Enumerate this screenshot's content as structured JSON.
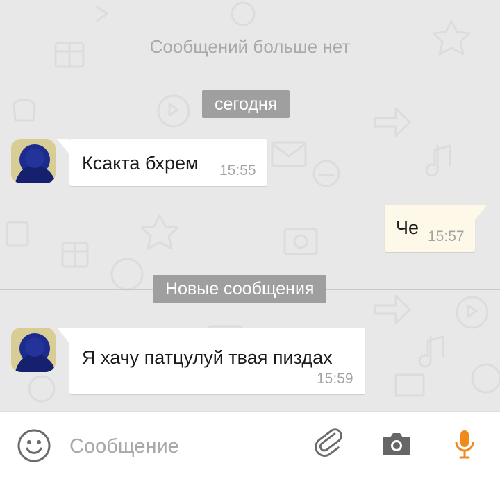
{
  "chat": {
    "no_more_label": "Сообщений больше нет",
    "date_label": "сегодня",
    "new_messages_label": "Новые сообщения",
    "messages": [
      {
        "direction": "incoming",
        "text": "Ксакта бхрем",
        "time": "15:55"
      },
      {
        "direction": "outgoing",
        "text": "Че",
        "time": "15:57"
      },
      {
        "direction": "incoming",
        "text": "Я хачу патцулуй твая пиздах",
        "time": "15:59"
      }
    ]
  },
  "composer": {
    "placeholder": "Сообщение",
    "value": ""
  },
  "icons": {
    "emoji": "smiley-icon",
    "attach": "paperclip-icon",
    "camera": "camera-icon",
    "mic": "microphone-icon"
  },
  "colors": {
    "accent_mic": "#f08a1e",
    "chip_bg": "#9f9f9f",
    "outgoing_bubble": "#fdf8e7",
    "incoming_bubble": "#ffffff",
    "chat_bg": "#e8e8e8"
  }
}
